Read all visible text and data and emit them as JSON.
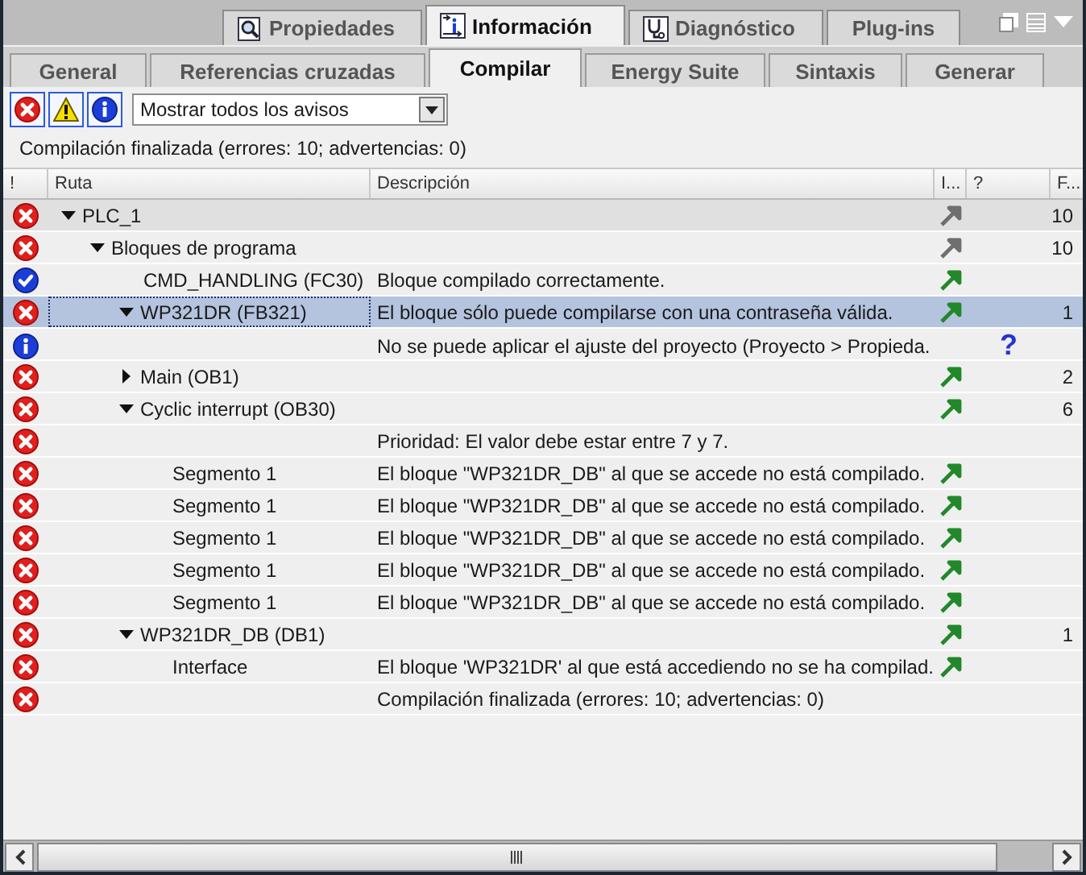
{
  "inspector_tabs": [
    {
      "label": "Propiedades",
      "selected": false
    },
    {
      "label": "Información",
      "selected": true
    },
    {
      "label": "Diagnóstico",
      "selected": false
    },
    {
      "label": "Plug-ins",
      "selected": false
    }
  ],
  "sub_tabs": [
    {
      "label": "General",
      "selected": false
    },
    {
      "label": "Referencias cruzadas",
      "selected": false
    },
    {
      "label": "Compilar",
      "selected": true
    },
    {
      "label": "Energy Suite",
      "selected": false
    },
    {
      "label": "Sintaxis",
      "selected": false
    },
    {
      "label": "Generar",
      "selected": false
    }
  ],
  "filters": [
    {
      "kind": "error",
      "on": true
    },
    {
      "kind": "warning",
      "on": true
    },
    {
      "kind": "info",
      "on": true
    }
  ],
  "filter_dropdown": {
    "value": "Mostrar todos los avisos"
  },
  "summary": "Compilación finalizada (errores: 10; advertencias: 0)",
  "table": {
    "columns": [
      "!",
      "Ruta",
      "Descripción",
      "I...",
      "?",
      "F..."
    ],
    "rows": [
      {
        "kind": "error",
        "path": "PLC_1",
        "expanded": true,
        "highlighted": true,
        "link": {
          "disabled": true
        },
        "count": "10",
        "selected": false,
        "children": [
          {
            "kind": "error",
            "path": "Bloques de programa",
            "expanded": true,
            "link": {
              "disabled": true
            },
            "count": "10",
            "selected": false,
            "children": [
              {
                "kind": "ok",
                "path": "CMD_HANDLING (FC30)",
                "description": "Bloque compilado correctamente.",
                "link": {
                  "disabled": false
                },
                "selected": false
              },
              {
                "kind": "error",
                "path": "WP321DR (FB321)",
                "expanded": true,
                "description": "El bloque sólo puede compilarse con una contraseña válida.",
                "link": {
                  "disabled": false
                },
                "count": "1",
                "selected": true,
                "children": [
                  {
                    "kind": "info",
                    "description": "No se puede aplicar el ajuste del proyecto (Proyecto > Propieda.",
                    "help": "?",
                    "selected": false
                  }
                ]
              },
              {
                "kind": "error",
                "path": "Main (OB1)",
                "expanded": false,
                "link": {
                  "disabled": false
                },
                "count": "2",
                "selected": false
              },
              {
                "kind": "error",
                "path": "Cyclic interrupt (OB30)",
                "expanded": true,
                "link": {
                  "disabled": false
                },
                "count": "6",
                "selected": false,
                "children": [
                  {
                    "kind": "error",
                    "description": "Prioridad: El valor debe estar entre 7 y 7.",
                    "selected": false
                  },
                  {
                    "kind": "error",
                    "path": "Segmento 1",
                    "description": "El bloque \"WP321DR_DB\" al que se accede no está compilado.",
                    "link": {
                      "disabled": false
                    },
                    "selected": false
                  },
                  {
                    "kind": "error",
                    "path": "Segmento 1",
                    "description": "El bloque \"WP321DR_DB\" al que se accede no está compilado.",
                    "link": {
                      "disabled": false
                    },
                    "selected": false
                  },
                  {
                    "kind": "error",
                    "path": "Segmento 1",
                    "description": "El bloque \"WP321DR_DB\" al que se accede no está compilado.",
                    "link": {
                      "disabled": false
                    },
                    "selected": false
                  },
                  {
                    "kind": "error",
                    "path": "Segmento 1",
                    "description": "El bloque \"WP321DR_DB\" al que se accede no está compilado.",
                    "link": {
                      "disabled": false
                    },
                    "selected": false
                  },
                  {
                    "kind": "error",
                    "path": "Segmento 1",
                    "description": "El bloque \"WP321DR_DB\" al que se accede no está compilado.",
                    "link": {
                      "disabled": false
                    },
                    "selected": false
                  }
                ]
              },
              {
                "kind": "error",
                "path": "WP321DR_DB (DB1)",
                "expanded": true,
                "link": {
                  "disabled": false
                },
                "count": "1",
                "selected": false,
                "children": [
                  {
                    "kind": "error",
                    "path": "Interface",
                    "description": "El bloque 'WP321DR' al que está accediendo no se ha compilad.",
                    "link": {
                      "disabled": false
                    },
                    "selected": false
                  }
                ]
              }
            ]
          }
        ]
      },
      {
        "kind": "error",
        "description": "Compilación finalizada (errores: 10; advertencias: 0)",
        "selected": false
      }
    ]
  }
}
